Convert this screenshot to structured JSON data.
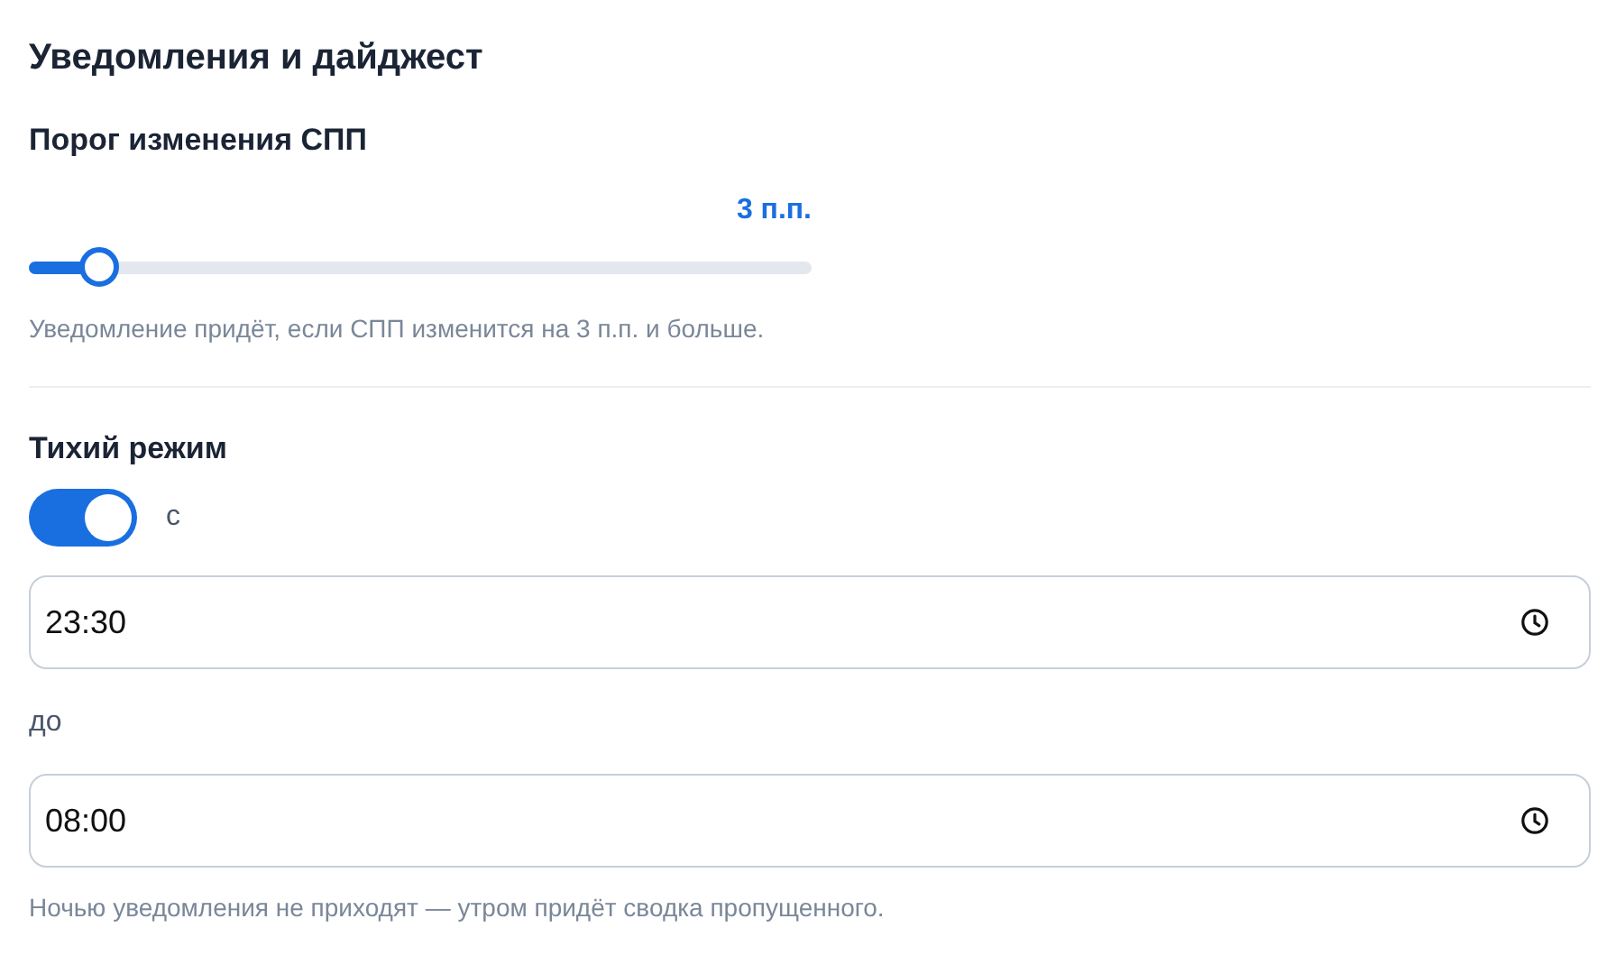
{
  "section": {
    "title": "Уведомления и дайджест"
  },
  "threshold": {
    "label": "Порог изменения СПП",
    "value": "3 п.п.",
    "level": 0.09,
    "hint": "Уведомление придёт, если СПП изменится на 3 п.п. и больше."
  },
  "quiet": {
    "label": "Тихий режим",
    "on": true,
    "from_label": "с",
    "from": "23:30",
    "to_label": "до",
    "to": "08:00",
    "hint": "Ночью уведомления не приходят — утром придёт сводка пропущенного."
  }
}
